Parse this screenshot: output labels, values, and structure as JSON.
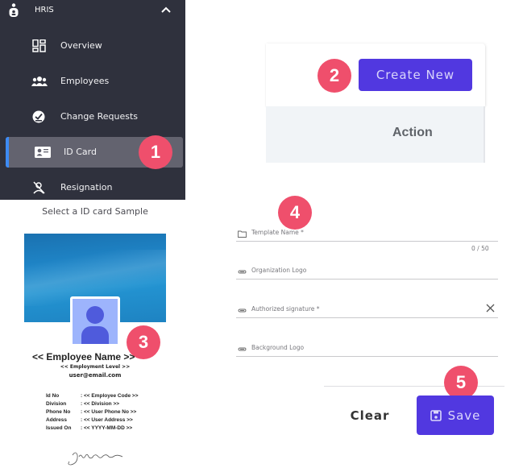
{
  "sidebar": {
    "section_label": "HRIS",
    "section_icon": "person-badge-icon",
    "items": [
      {
        "label": "Overview",
        "icon": "dashboard-grid-icon",
        "active": false
      },
      {
        "label": "Employees",
        "icon": "people-group-icon",
        "active": false
      },
      {
        "label": "Change Requests",
        "icon": "check-circle-icon",
        "active": false
      },
      {
        "label": "ID Card",
        "icon": "id-card-icon",
        "active": true
      },
      {
        "label": "Resignation",
        "icon": "user-off-icon",
        "active": false
      }
    ]
  },
  "colors": {
    "sidebar_bg": "#2f313d",
    "active_item_bg": "#63636f",
    "active_indicator": "#3d8bf5",
    "primary_button": "#5138e0",
    "badge": "#ef4f6c"
  },
  "badges": [
    "1",
    "2",
    "3",
    "4",
    "5"
  ],
  "list_panel": {
    "create_button_label": "Create New",
    "table_header_action": "Action"
  },
  "id_card_sample": {
    "caption": "Select a ID card Sample",
    "employee_name": "<< Employee Name >>",
    "employment_level": "<< Employment Level >>",
    "email": "user@email.com",
    "details": [
      {
        "key": "Id No",
        "value": ": << Employee Code >>"
      },
      {
        "key": "Division",
        "value": ": << Division >>"
      },
      {
        "key": "Phone No",
        "value": ": << User Phone No >>"
      },
      {
        "key": "Address",
        "value": ": << User Address >>"
      },
      {
        "key": "Issued On",
        "value": ": << YYYY-MM-DD >>"
      }
    ]
  },
  "form": {
    "fields": [
      {
        "label": "Template Name *",
        "icon": "folder-icon",
        "value": ""
      },
      {
        "label": "Organization Logo",
        "icon": "paperclip-icon",
        "value": ""
      },
      {
        "label": "Authorized signature *",
        "icon": "paperclip-icon",
        "value": "",
        "clearable": true
      },
      {
        "label": "Background Logo",
        "icon": "paperclip-icon",
        "value": ""
      }
    ],
    "template_name_counter": "0 / 50",
    "clear_label": "Clear",
    "save_label": "Save"
  }
}
